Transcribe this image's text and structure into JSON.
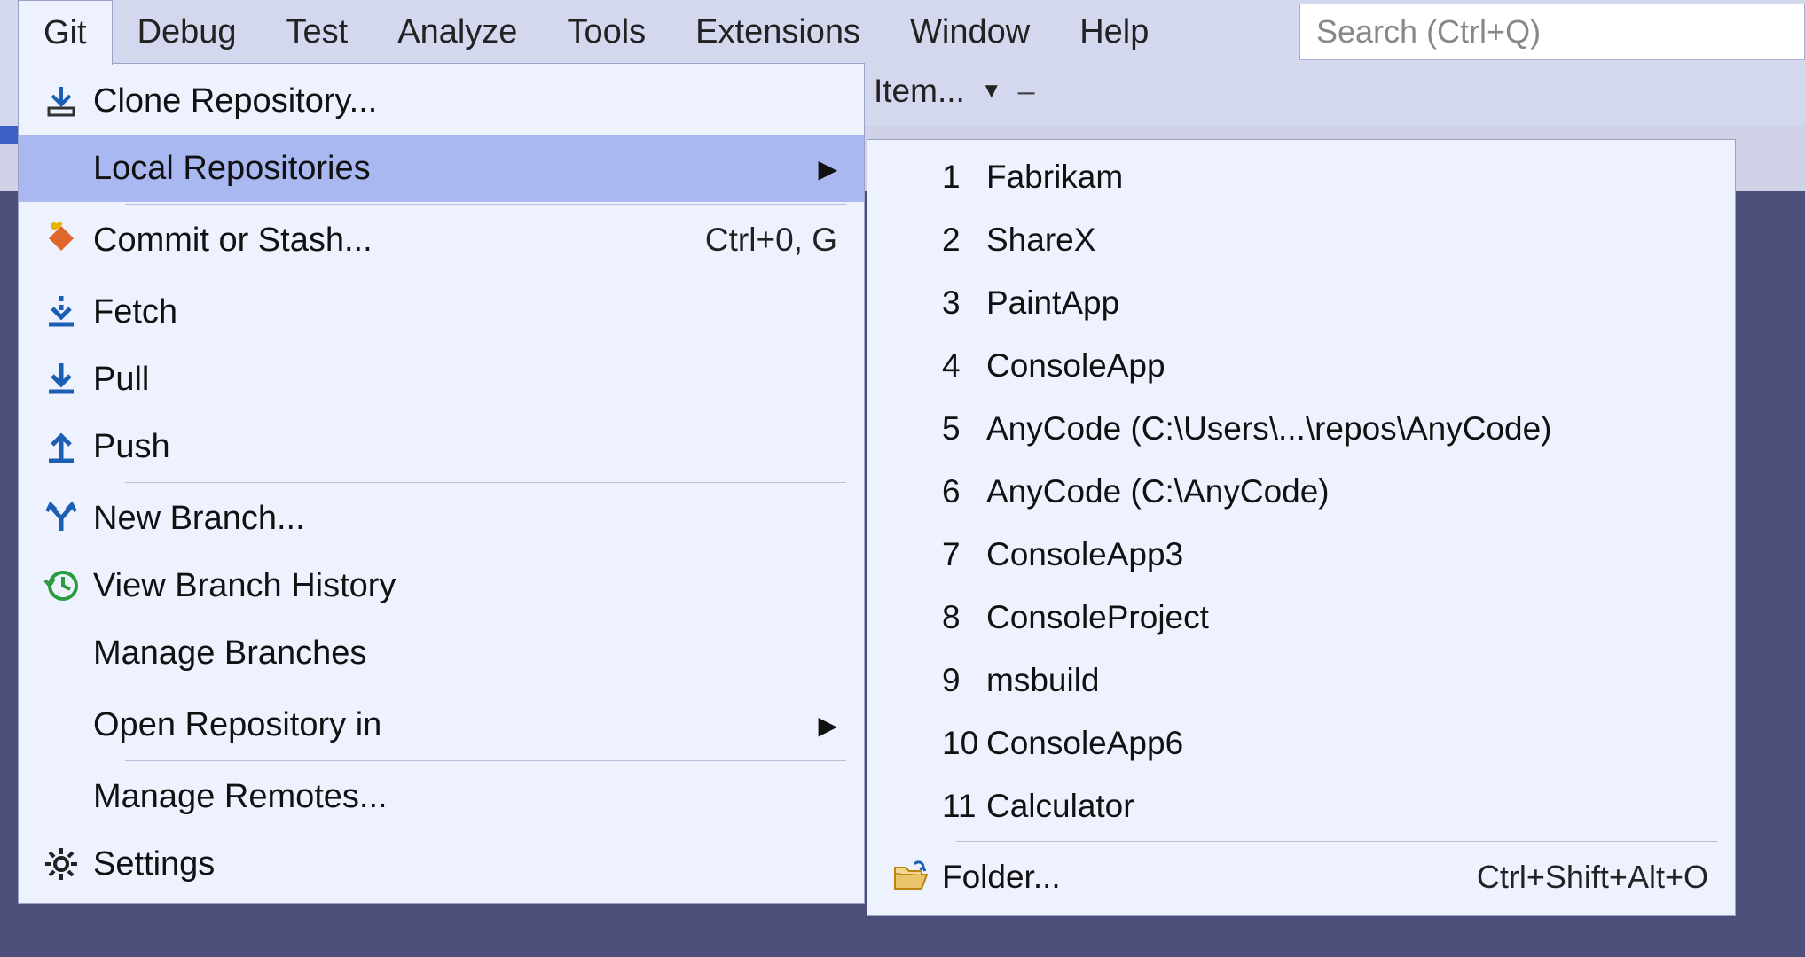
{
  "menubar": {
    "items": [
      "Git",
      "Debug",
      "Test",
      "Analyze",
      "Tools",
      "Extensions",
      "Window",
      "Help"
    ]
  },
  "search": {
    "placeholder": "Search (Ctrl+Q)"
  },
  "toolbar_fragment": "Item...",
  "git_menu": {
    "clone": "Clone Repository...",
    "local_repos": "Local Repositories",
    "commit": "Commit or Stash...",
    "commit_key": "Ctrl+0, G",
    "fetch": "Fetch",
    "pull": "Pull",
    "push": "Push",
    "new_branch": "New Branch...",
    "view_history": "View Branch History",
    "manage_branches": "Manage Branches",
    "open_repo_in": "Open Repository in",
    "manage_remotes": "Manage Remotes...",
    "settings": "Settings"
  },
  "local_repos": {
    "items": [
      {
        "n": "1",
        "label": "Fabrikam"
      },
      {
        "n": "2",
        "label": "ShareX"
      },
      {
        "n": "3",
        "label": "PaintApp"
      },
      {
        "n": "4",
        "label": "ConsoleApp"
      },
      {
        "n": "5",
        "label": "AnyCode (C:\\Users\\...\\repos\\AnyCode)"
      },
      {
        "n": "6",
        "label": "AnyCode (C:\\AnyCode)"
      },
      {
        "n": "7",
        "label": "ConsoleApp3"
      },
      {
        "n": "8",
        "label": "ConsoleProject"
      },
      {
        "n": "9",
        "label": "msbuild"
      },
      {
        "n": "10",
        "label": "ConsoleApp6"
      },
      {
        "n": "11",
        "label": "Calculator"
      }
    ],
    "folder_label": "Folder...",
    "folder_key": "Ctrl+Shift+Alt+O"
  }
}
